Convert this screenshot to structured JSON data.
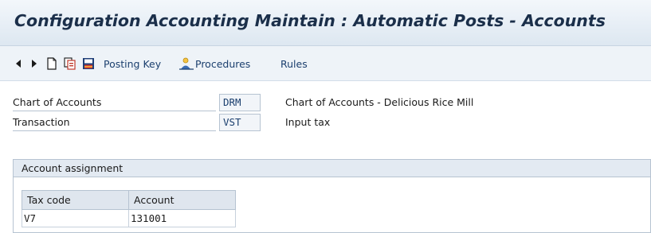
{
  "window": {
    "title": "Configuration Accounting Maintain : Automatic Posts - Accounts"
  },
  "toolbar": {
    "back_icon": "triangle-left",
    "forward_icon": "triangle-right",
    "new_icon": "blank-document",
    "copy_icon": "copy-documents",
    "save_icon": "save-disk",
    "posting_key_label": "Posting Key",
    "procedures_icon": "person-procedure",
    "procedures_label": "Procedures",
    "rules_label": "Rules"
  },
  "header_fields": {
    "chart_of_accounts": {
      "label": "Chart of Accounts",
      "value": "DRM",
      "description": "Chart of Accounts - Delicious Rice Mill"
    },
    "transaction": {
      "label": "Transaction",
      "value": "VST",
      "description": "Input tax"
    }
  },
  "account_assignment": {
    "title": "Account assignment",
    "columns": [
      "Tax code",
      "Account"
    ],
    "rows": [
      [
        "V7",
        "131001"
      ]
    ]
  },
  "colors": {
    "title_bg": "#dde7f1",
    "toolbar_bg": "#eef3f8",
    "link_text": "#1b3f6e",
    "border": "#b6c3d1"
  }
}
